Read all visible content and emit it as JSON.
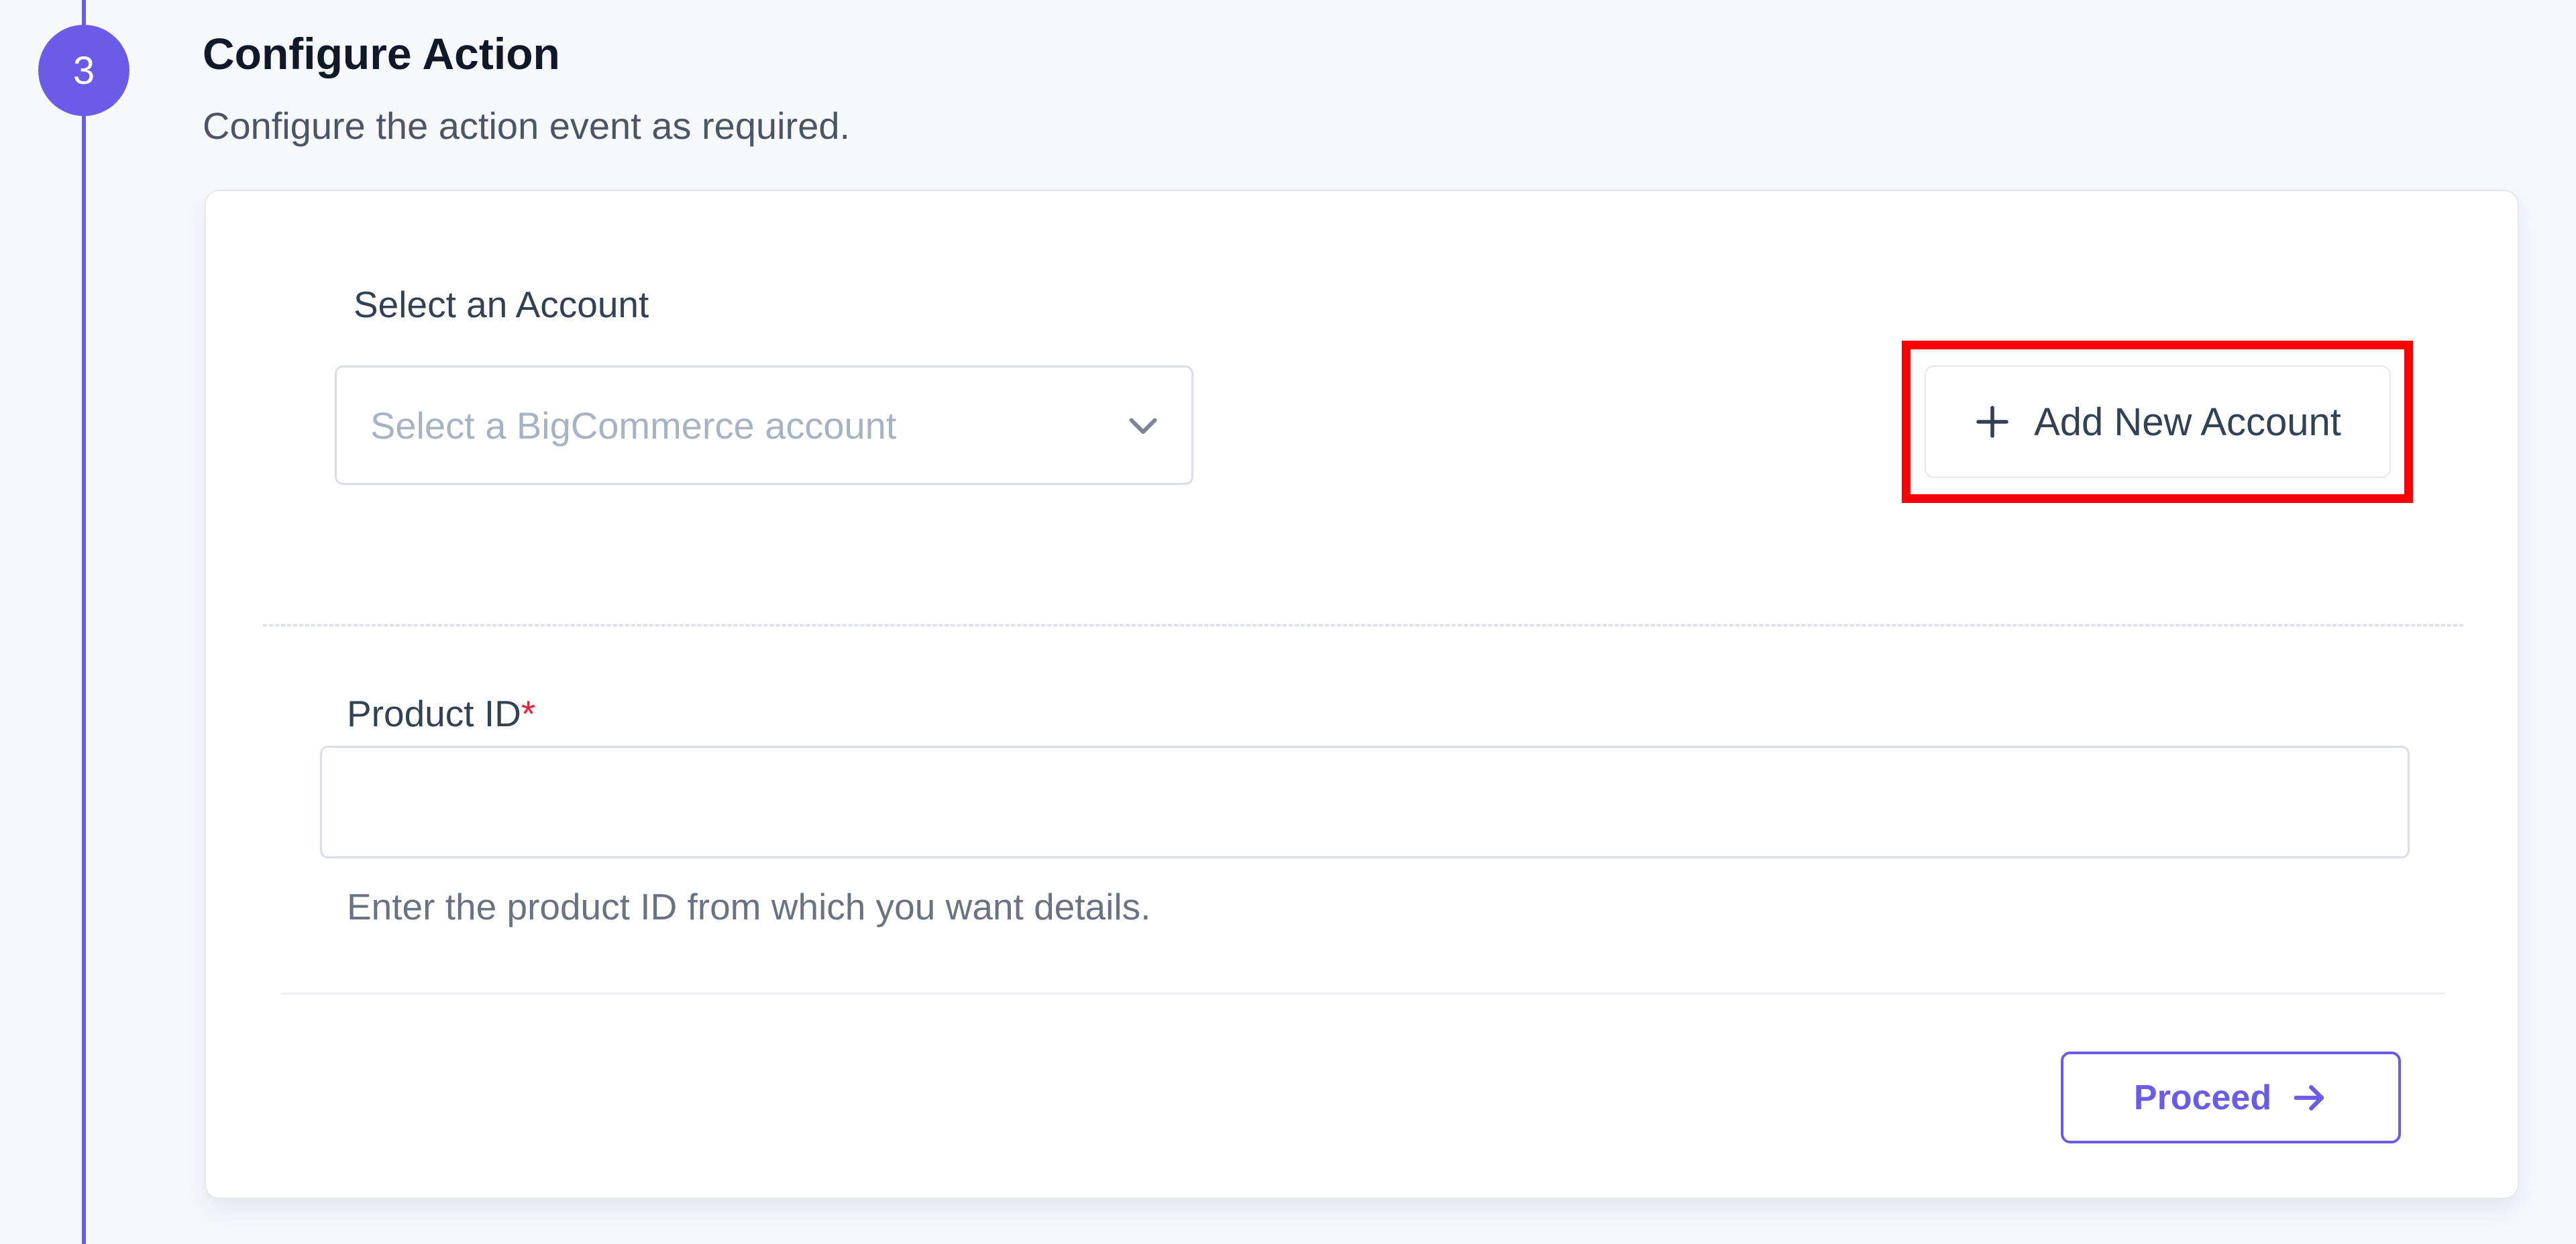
{
  "step": {
    "number": "3",
    "title": "Configure Action",
    "subtitle": "Configure the action event as required."
  },
  "account": {
    "label": "Select an Account",
    "select_placeholder": "Select a BigCommerce account",
    "add_button_label": "Add New Account"
  },
  "product": {
    "label": "Product ID",
    "required_marker": "*",
    "input_value": "",
    "help_text": "Enter the product ID from which you want details."
  },
  "footer": {
    "proceed_label": "Proceed"
  },
  "colors": {
    "accent": "#6b5ce7",
    "required": "#ef1d3a",
    "highlight": "#ff0000"
  },
  "icons": {
    "select_chevron": "chevron-down-icon",
    "add": "plus-icon",
    "proceed": "arrow-right-icon"
  }
}
